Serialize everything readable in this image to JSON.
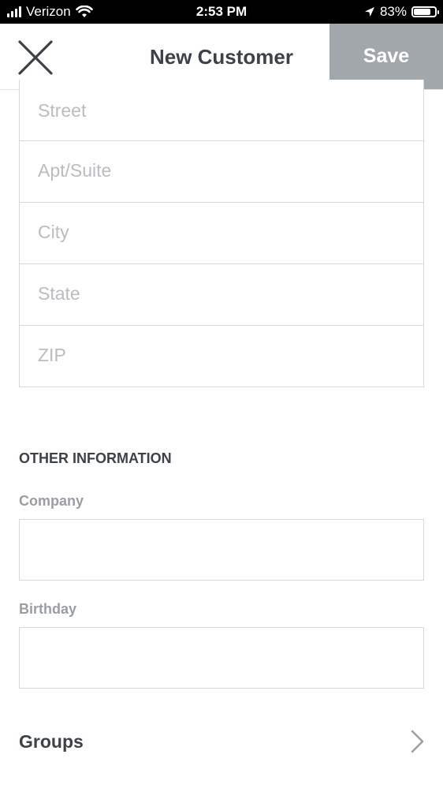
{
  "status_bar": {
    "carrier": "Verizon",
    "time": "2:53 PM",
    "battery_percent": "83%",
    "battery_level": 0.83,
    "icons": [
      "signal-icon",
      "wifi-icon",
      "location-arrow-icon",
      "battery-icon"
    ]
  },
  "nav": {
    "title": "New Customer",
    "save_label": "Save",
    "close_icon": "close-icon",
    "save_bg_color": "#a2a7ab"
  },
  "address": {
    "fields": [
      {
        "placeholder": "Street"
      },
      {
        "placeholder": "Apt/Suite"
      },
      {
        "placeholder": "City"
      },
      {
        "placeholder": "State"
      },
      {
        "placeholder": "ZIP"
      }
    ]
  },
  "other_information": {
    "section_title": "OTHER INFORMATION",
    "company_label": "Company",
    "company_value": "",
    "birthday_label": "Birthday",
    "birthday_value": ""
  },
  "groups": {
    "label": "Groups",
    "icon": "chevron-right-icon"
  }
}
